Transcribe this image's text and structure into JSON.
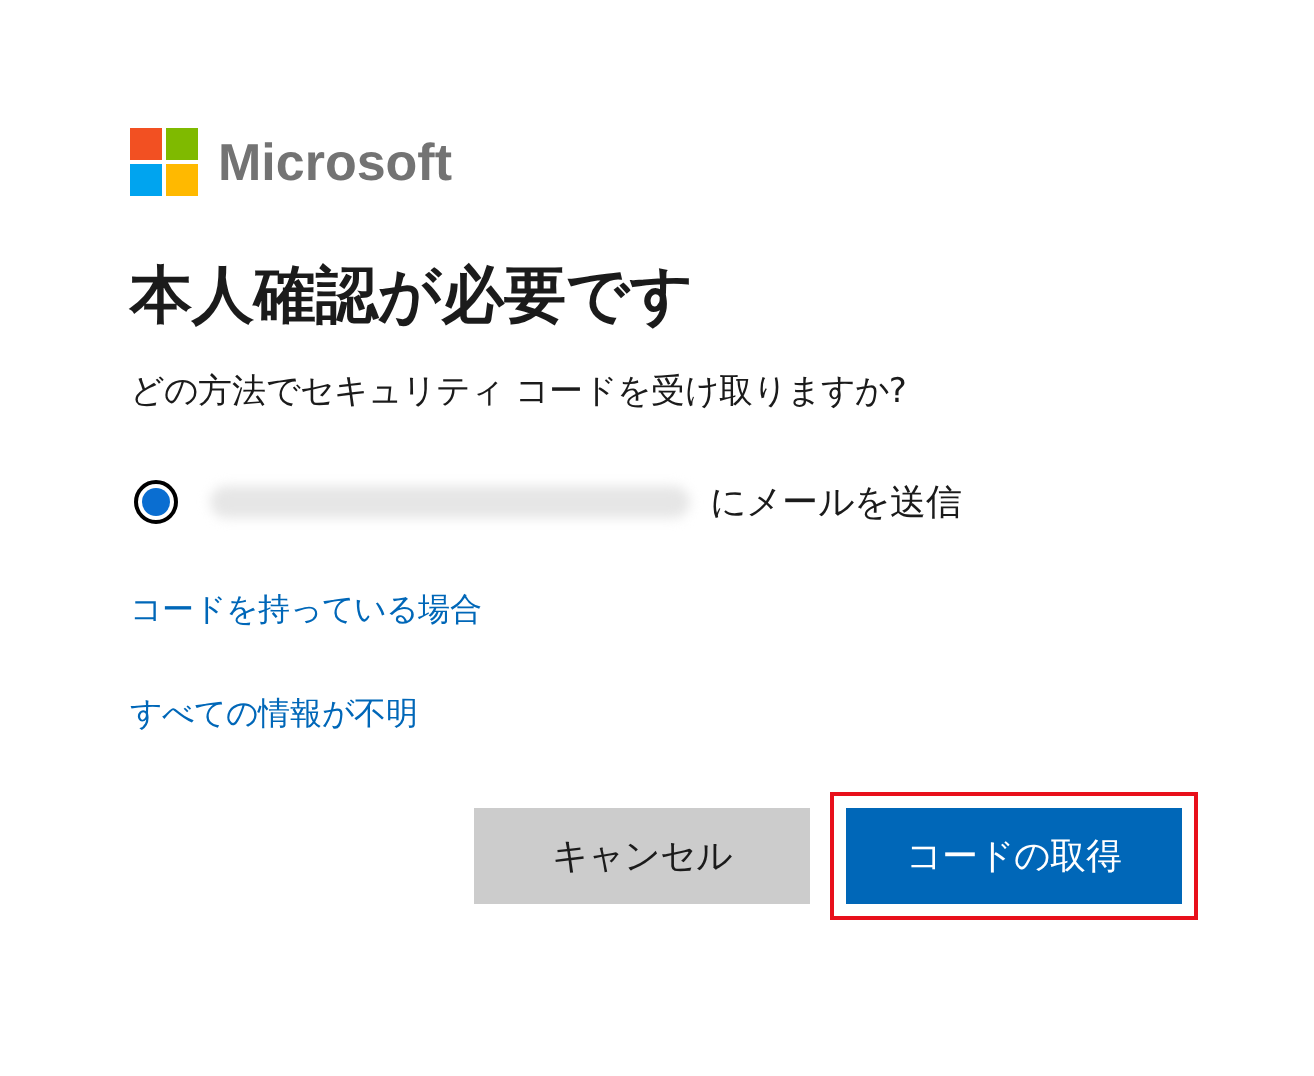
{
  "logo": {
    "wordmark": "Microsoft"
  },
  "title": "本人確認が必要です",
  "question": "どの方法でセキュリティ コードを受け取りますか?",
  "options": [
    {
      "label": "にメールを送信",
      "selected": true,
      "address_hidden": true
    }
  ],
  "links": [
    "コードを持っている場合",
    "すべての情報が不明"
  ],
  "buttons": [
    {
      "label": "キャンセル",
      "kind": "secondary",
      "highlighted": false
    },
    {
      "label": "コードの取得",
      "kind": "primary",
      "highlighted": true
    }
  ]
}
